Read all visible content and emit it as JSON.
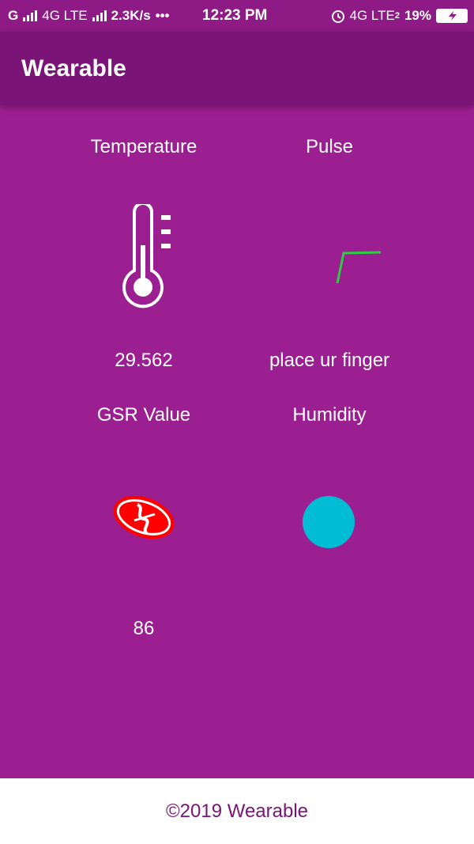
{
  "status_bar": {
    "left_text": "G",
    "network1": "4G LTE",
    "speed": "2.3K/s",
    "dots": "•••",
    "time": "12:23 PM",
    "network2": "4G LTE",
    "sim2": "2",
    "battery": "19%"
  },
  "toolbar": {
    "title": "Wearable"
  },
  "cards": {
    "temperature": {
      "label": "Temperature",
      "value": "29.562"
    },
    "pulse": {
      "label": "Pulse",
      "value": "place ur finger",
      "line_color": "#2ecc40"
    },
    "gsr": {
      "label": "GSR Value",
      "value": "86",
      "icon_color": "#ff0000"
    },
    "humidity": {
      "label": "Humidity",
      "value": "",
      "dot_color": "#00bcd4"
    }
  },
  "footer": {
    "text": "©2019 Wearable"
  }
}
